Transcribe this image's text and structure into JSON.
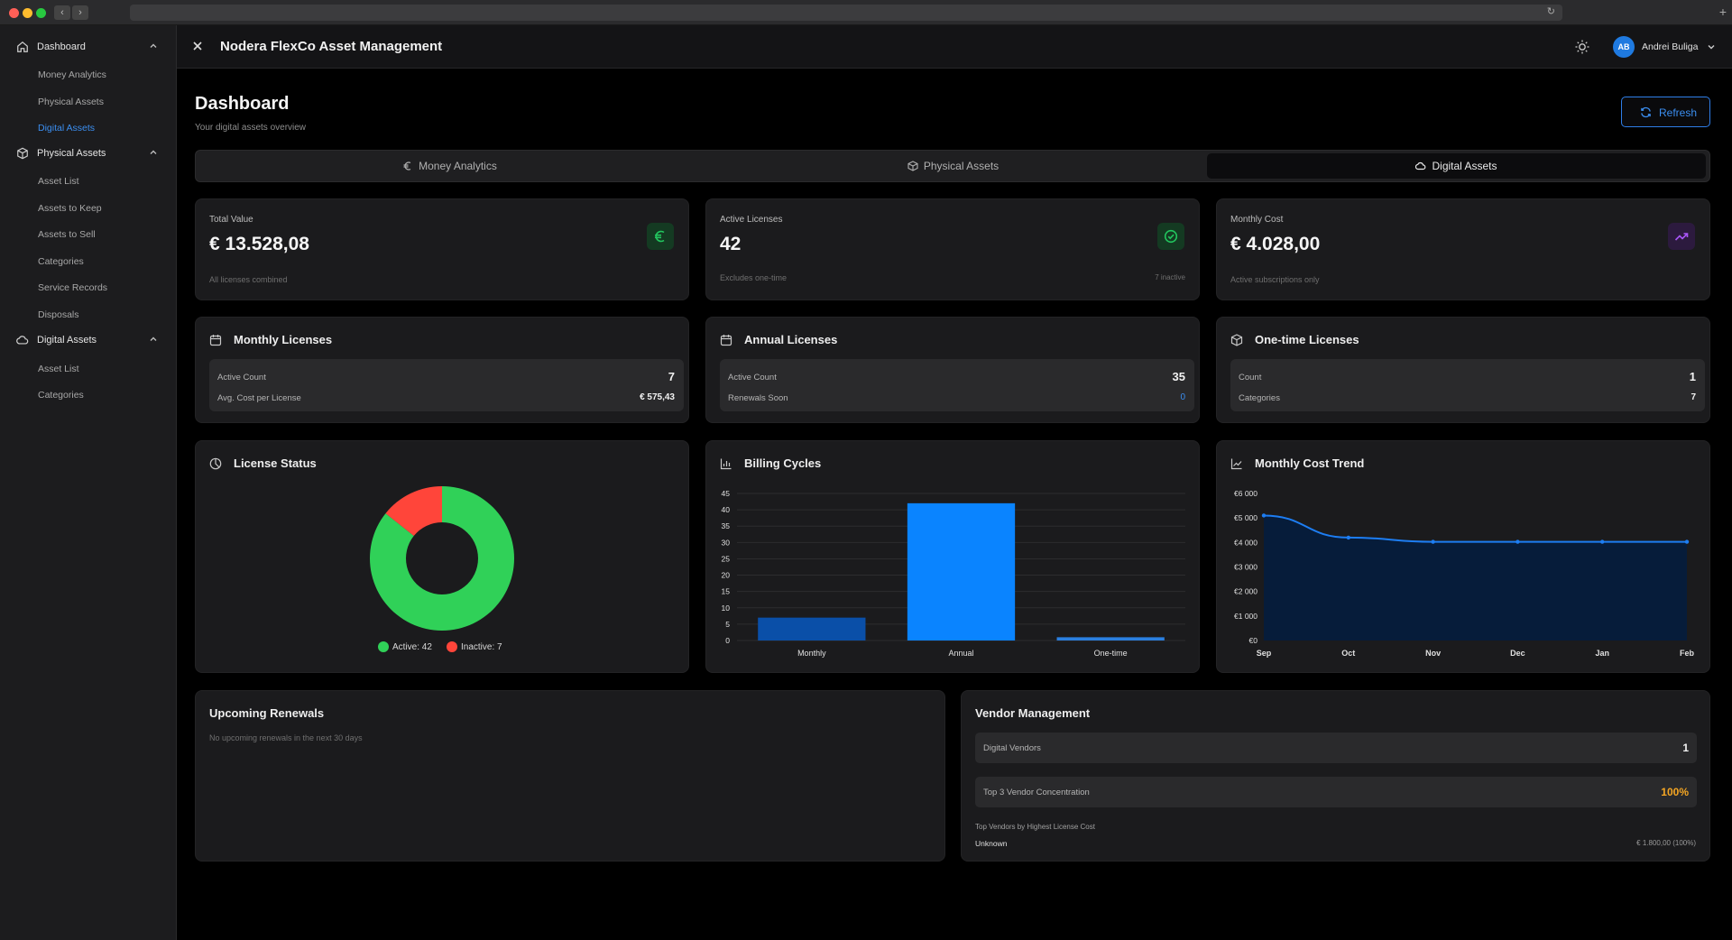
{
  "sidebar": {
    "groups": [
      {
        "label": "Dashboard",
        "items": [
          "Money Analytics",
          "Physical Assets",
          "Digital Assets"
        ]
      },
      {
        "label": "Physical Assets",
        "items": [
          "Asset List",
          "Assets to Keep",
          "Assets to Sell",
          "Categories",
          "Service Records",
          "Disposals"
        ]
      },
      {
        "label": "Digital Assets",
        "items": [
          "Asset List",
          "Categories"
        ]
      }
    ],
    "active_item": "Digital Assets"
  },
  "header": {
    "app_title": "Nodera FlexCo Asset Management",
    "user_initials": "AB",
    "user_name": "Andrei Buliga"
  },
  "page": {
    "title": "Dashboard",
    "subtitle": "Your digital assets overview",
    "refresh_label": "Refresh"
  },
  "tabs": [
    {
      "label": "Money Analytics",
      "icon": "euro-icon"
    },
    {
      "label": "Physical Assets",
      "icon": "package-icon"
    },
    {
      "label": "Digital Assets",
      "icon": "cloud-icon",
      "active": true
    }
  ],
  "kpis": [
    {
      "label": "Total Value",
      "value": "€ 13.528,08",
      "foot": "All licenses combined",
      "icon": "euro-icon",
      "color": "#22c55e"
    },
    {
      "label": "Active Licenses",
      "value": "42",
      "foot": "Excludes one-time",
      "foot_right": "7 inactive",
      "icon": "check-circle-icon",
      "color": "#22c55e"
    },
    {
      "label": "Monthly Cost",
      "value": "€ 4.028,00",
      "foot": "Active subscriptions only",
      "icon": "trending-up-icon",
      "color": "#a855f7"
    }
  ],
  "license_cards": [
    {
      "title": "Monthly Licenses",
      "icon": "calendar-icon",
      "rows": [
        {
          "label": "Active Count",
          "value": "7"
        },
        {
          "label": "Avg. Cost per License",
          "value": "€ 575,43"
        }
      ]
    },
    {
      "title": "Annual Licenses",
      "icon": "calendar-icon",
      "rows": [
        {
          "label": "Active Count",
          "value": "35"
        },
        {
          "label": "Renewals Soon",
          "value": "0"
        }
      ]
    },
    {
      "title": "One-time Licenses",
      "icon": "package-icon",
      "rows": [
        {
          "label": "Count",
          "value": "1"
        },
        {
          "label": "Categories",
          "value": "7"
        }
      ]
    }
  ],
  "charts": {
    "status_title": "License Status",
    "billing_title": "Billing Cycles",
    "trend_title": "Monthly Cost Trend"
  },
  "chart_data": [
    {
      "type": "pie",
      "title": "License Status",
      "categories": [
        "Active",
        "Inactive"
      ],
      "values": [
        42,
        7
      ],
      "legend": [
        "Active: 42",
        "Inactive: 7"
      ],
      "colors": [
        "#30d158",
        "#ff453a"
      ]
    },
    {
      "type": "bar",
      "title": "Billing Cycles",
      "categories": [
        "Monthly",
        "Annual",
        "One-time"
      ],
      "values": [
        7,
        42,
        1
      ],
      "ylim": [
        0,
        45
      ],
      "yticks": [
        0,
        5,
        10,
        15,
        20,
        25,
        30,
        35,
        40,
        45
      ],
      "colors": [
        "#0a4fa8",
        "#0a84ff",
        "#2b7fe0"
      ]
    },
    {
      "type": "area",
      "title": "Monthly Cost Trend",
      "categories": [
        "Sep",
        "Oct",
        "Nov",
        "Dec",
        "Jan",
        "Feb"
      ],
      "values": [
        5100,
        4200,
        4028,
        4028,
        4028,
        4028
      ],
      "ylim": [
        0,
        6000
      ],
      "yticks": [
        "€0",
        "€1 000",
        "€2 000",
        "€3 000",
        "€4 000",
        "€5 000",
        "€6 000"
      ],
      "line_color": "#1d7df2",
      "fill_color": "#061c3a"
    }
  ],
  "renewals": {
    "title": "Upcoming Renewals",
    "empty_text": "No upcoming renewals in the next 30 days"
  },
  "vendors": {
    "title": "Vendor Management",
    "rows": [
      {
        "label": "Digital Vendors",
        "value": "1"
      },
      {
        "label": "Top 3 Vendor Concentration",
        "value": "100%"
      }
    ],
    "top_title": "Top Vendors by Highest License Cost",
    "top": [
      {
        "name": "Unknown",
        "value": "€ 1.800,00 (100%)"
      }
    ]
  }
}
